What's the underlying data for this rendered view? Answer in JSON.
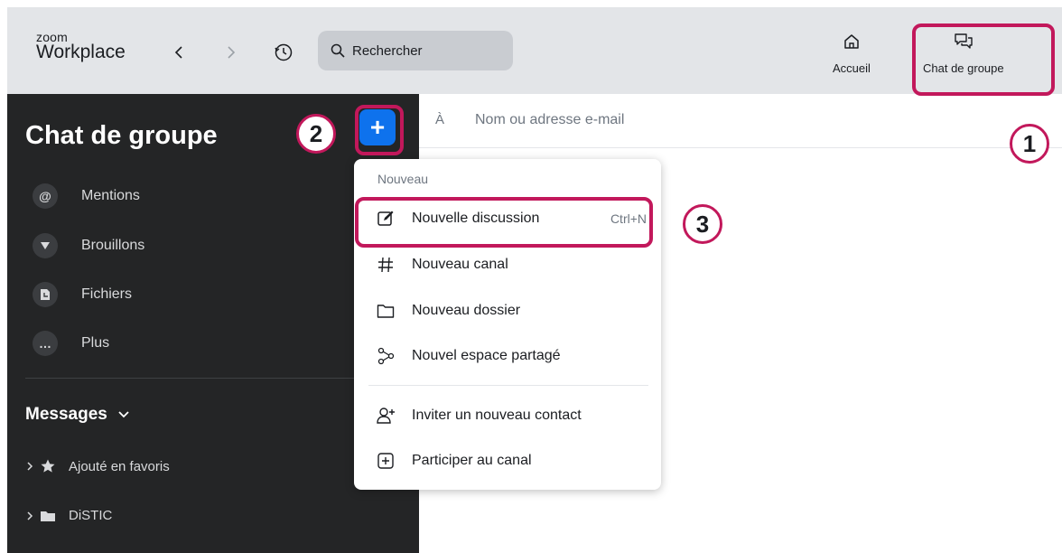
{
  "app": {
    "logo_small": "zoom",
    "logo_large": "Workplace"
  },
  "toolbar": {
    "back_icon": "chevron-left-icon",
    "forward_icon": "chevron-right-icon",
    "history_icon": "history-icon",
    "search_placeholder": "Rechercher",
    "nav": [
      {
        "label": "Accueil",
        "icon": "home-icon"
      },
      {
        "label": "Chat de groupe",
        "icon": "chat-icon"
      }
    ]
  },
  "sidebar": {
    "title": "Chat de groupe",
    "add_button": "+",
    "items": [
      {
        "label": "Mentions",
        "icon": "@"
      },
      {
        "label": "Brouillons",
        "icon": "draft-icon"
      },
      {
        "label": "Fichiers",
        "icon": "files-icon"
      },
      {
        "label": "Plus",
        "icon": "…"
      }
    ],
    "section_title": "Messages",
    "folders": [
      {
        "label": "Ajouté en favoris",
        "icon": "star-icon"
      },
      {
        "label": "DiSTIC",
        "icon": "folder-icon"
      }
    ]
  },
  "compose": {
    "to_label": "À",
    "to_placeholder": "Nom ou adresse e-mail"
  },
  "menu": {
    "header": "Nouveau",
    "items": [
      {
        "label": "Nouvelle discussion",
        "shortcut": "Ctrl+N",
        "icon": "edit-icon"
      },
      {
        "label": "Nouveau canal",
        "icon": "hash-icon"
      },
      {
        "label": "Nouveau dossier",
        "icon": "folder-outline-icon"
      },
      {
        "label": "Nouvel espace partagé",
        "icon": "shared-space-icon"
      },
      {
        "label": "Inviter un nouveau contact",
        "icon": "add-contact-icon"
      },
      {
        "label": "Participer au canal",
        "icon": "plus-square-icon"
      }
    ]
  },
  "annotations": {
    "step1": "1",
    "step2": "2",
    "step3": "3"
  },
  "colors": {
    "accent": "#0e72ed",
    "highlight": "#c2185b",
    "sidebar_bg": "#242526",
    "topbar_bg": "#e3e5e8"
  }
}
